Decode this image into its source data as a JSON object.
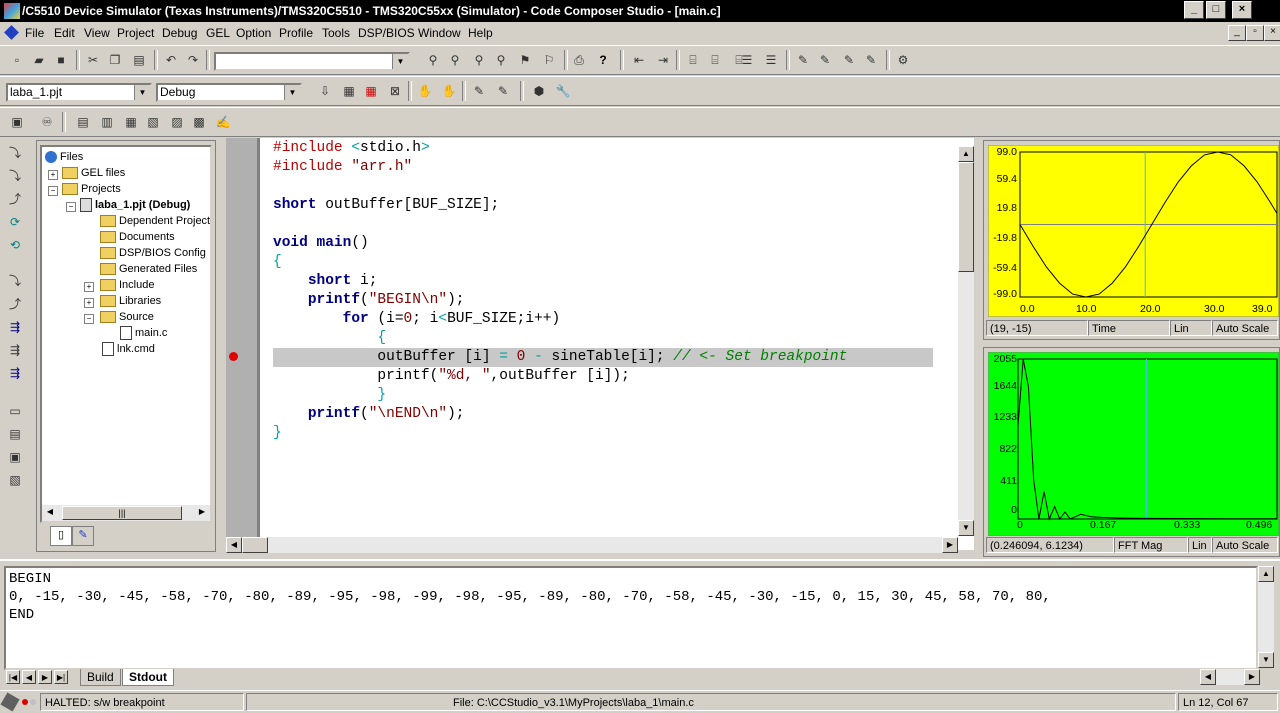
{
  "window": {
    "title": "/C5510 Device Simulator (Texas Instruments)/TMS320C5510 - TMS320C55xx (Simulator) - Code Composer Studio - [main.c]",
    "min": "_",
    "max": "□",
    "close": "×"
  },
  "menu": [
    "File",
    "Edit",
    "View",
    "Project",
    "Debug",
    "GEL",
    "Option",
    "Profile",
    "Tools",
    "DSP/BIOS",
    "Window",
    "Help"
  ],
  "toolbar": {
    "project_combo": "laba_1.pjt",
    "config_combo": "Debug",
    "search_combo": ""
  },
  "tree": {
    "root": "Files",
    "items": [
      {
        "label": "GEL files"
      },
      {
        "label": "Projects"
      },
      {
        "label": "laba_1.pjt (Debug)"
      },
      {
        "label": "Dependent Project"
      },
      {
        "label": "Documents"
      },
      {
        "label": "DSP/BIOS Config"
      },
      {
        "label": "Generated Files"
      },
      {
        "label": "Include"
      },
      {
        "label": "Libraries"
      },
      {
        "label": "Source"
      },
      {
        "label": "main.c"
      },
      {
        "label": "lnk.cmd"
      }
    ]
  },
  "editor": {
    "lines": [
      {
        "parts": [
          [
            "pp",
            "#include "
          ],
          [
            "br",
            "<"
          ],
          [
            "",
            "stdio.h"
          ],
          [
            "br",
            ">"
          ]
        ]
      },
      {
        "parts": [
          [
            "pp",
            "#include "
          ],
          [
            "str",
            "\"arr.h\""
          ]
        ]
      },
      {
        "parts": []
      },
      {
        "parts": [
          [
            "kw",
            "short"
          ],
          [
            "",
            " outBuffer[BUF_SIZE];"
          ]
        ]
      },
      {
        "parts": []
      },
      {
        "parts": [
          [
            "kw",
            "void"
          ],
          [
            "",
            " "
          ],
          [
            "kw",
            "main"
          ],
          [
            "",
            "()"
          ]
        ]
      },
      {
        "parts": [
          [
            "br",
            "{"
          ]
        ]
      },
      {
        "parts": [
          [
            "",
            "    "
          ],
          [
            "kw",
            "short"
          ],
          [
            "",
            " i;"
          ]
        ]
      },
      {
        "parts": [
          [
            "",
            "    "
          ],
          [
            "kw",
            "printf"
          ],
          [
            "",
            "("
          ],
          [
            "str",
            "\"BEGIN\\n\""
          ],
          [
            "",
            ");"
          ]
        ]
      },
      {
        "parts": [
          [
            "",
            "        "
          ],
          [
            "kw",
            "for"
          ],
          [
            "",
            " (i="
          ],
          [
            "num",
            "0"
          ],
          [
            "",
            "; i"
          ],
          [
            "br",
            "<"
          ],
          [
            "",
            "BUF_SIZE;i++)"
          ]
        ]
      },
      {
        "parts": [
          [
            "",
            "            "
          ],
          [
            "br",
            "{"
          ]
        ]
      },
      {
        "parts": [
          [
            "",
            "            outBuffer [i] "
          ],
          [
            "br",
            "="
          ],
          [
            "",
            " "
          ],
          [
            "num",
            "0"
          ],
          [
            "",
            " "
          ],
          [
            "br",
            "-"
          ],
          [
            "",
            " sineTable[i]; "
          ],
          [
            "cm",
            "// <- Set breakpoint"
          ]
        ]
      },
      {
        "parts": [
          [
            "",
            "            printf("
          ],
          [
            "str",
            "\"%d, \""
          ],
          [
            "",
            ",outBuffer [i]);"
          ]
        ]
      },
      {
        "parts": [
          [
            "",
            "            "
          ],
          [
            "br",
            "}"
          ]
        ]
      },
      {
        "parts": [
          [
            "",
            "    "
          ],
          [
            "kw",
            "printf"
          ],
          [
            "",
            "("
          ],
          [
            "str",
            "\"\\nEND\\n\""
          ],
          [
            "",
            ");"
          ]
        ]
      },
      {
        "parts": [
          [
            "br",
            "}"
          ]
        ]
      }
    ]
  },
  "graph_time": {
    "bg": "#ffff00",
    "ylabels": [
      "99.0",
      "59.4",
      "19.8",
      "-19.8",
      "-59.4",
      "-99.0"
    ],
    "xlabels": [
      "0.0",
      "10.0",
      "20.0",
      "30.0",
      "39.0"
    ],
    "status_coord": "(19, -15)",
    "status_label": "Time",
    "status_scale": "Lin",
    "status_auto": "Auto Scale"
  },
  "graph_fft": {
    "bg": "#00ff00",
    "ylabels": [
      "2055",
      "1644",
      "1233",
      "822",
      "411",
      "0"
    ],
    "xlabels": [
      "0",
      "0.167",
      "0.333",
      "0.496"
    ],
    "status_coord": "(0.246094, 6.1234)",
    "status_label": "FFT Mag",
    "status_scale": "Lin",
    "status_auto": "Auto Scale"
  },
  "chart_data": [
    {
      "type": "line",
      "title": "",
      "xlabel": "",
      "ylabel": "",
      "x": [
        0,
        2,
        4,
        6,
        8,
        10,
        12,
        14,
        16,
        18,
        20,
        22,
        24,
        26,
        28,
        30,
        32,
        34,
        36,
        38,
        39
      ],
      "series": [
        {
          "values": [
            0,
            -30,
            -58,
            -80,
            -95,
            -99,
            -95,
            -80,
            -58,
            -30,
            0,
            30,
            58,
            80,
            95,
            99,
            95,
            80,
            58,
            30,
            15
          ]
        }
      ],
      "xlim": [
        0,
        39
      ],
      "ylim": [
        -99,
        99
      ],
      "grid": false
    },
    {
      "type": "line",
      "title": "",
      "xlabel": "",
      "ylabel": "",
      "x": [
        0,
        0.01,
        0.02,
        0.03,
        0.04,
        0.05,
        0.06,
        0.07,
        0.08,
        0.09,
        0.1,
        0.12,
        0.14,
        0.16,
        0.2,
        0.25,
        0.3,
        0.35,
        0.4,
        0.45,
        0.496
      ],
      "series": [
        {
          "values": [
            1200,
            2055,
            1700,
            500,
            0,
            350,
            0,
            160,
            0,
            90,
            0,
            60,
            30,
            20,
            12,
            8,
            6,
            5,
            4,
            3,
            2
          ]
        }
      ],
      "xlim": [
        0,
        0.496
      ],
      "ylim": [
        0,
        2055
      ],
      "grid": false
    }
  ],
  "output": {
    "lines": [
      "BEGIN",
      "0, -15, -30, -45, -58, -70, -80, -89, -95, -98, -99, -98, -95, -89, -80, -70, -58, -45, -30, -15, 0, 15, 30, 45, 58, 70, 80,",
      "END"
    ],
    "tabs": [
      "Build",
      "Stdout"
    ]
  },
  "status": {
    "state": "HALTED: s/w breakpoint",
    "file": "File: C:\\CCStudio_v3.1\\MyProjects\\laba_1\\main.c",
    "position": "Ln 12, Col 67"
  },
  "icons": [
    "app-icon",
    "new-file-icon",
    "open-icon",
    "save-icon",
    "cut-icon",
    "copy-icon",
    "paste-icon",
    "undo-icon",
    "redo-icon",
    "help-icon",
    "build-icon",
    "breakpoint-icon"
  ]
}
